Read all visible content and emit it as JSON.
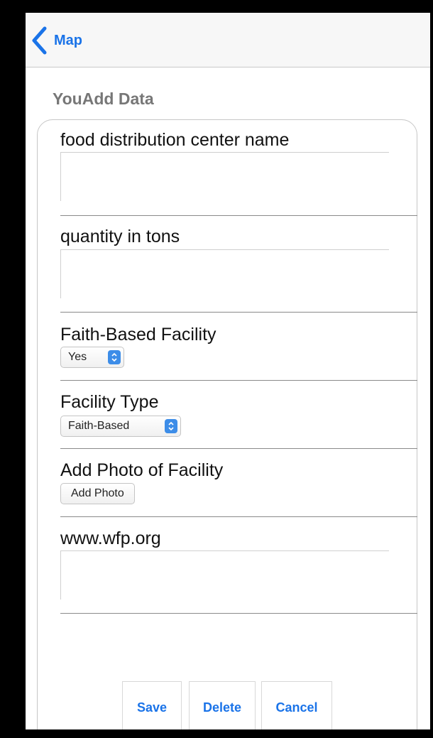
{
  "navbar": {
    "back_label": "Map",
    "back_icon": "chevron-left-icon",
    "accent_color": "#1a73e8"
  },
  "page": {
    "title": "YouAdd Data"
  },
  "form": {
    "name_label": "food distribution center name",
    "name_value": "",
    "quantity_label": "quantity in tons",
    "quantity_value": "",
    "faith_label": "Faith-Based Facility",
    "faith_selected": "Yes",
    "type_label": "Facility Type",
    "type_selected": "Faith-Based",
    "photo_label": "Add Photo of Facility",
    "photo_button": "Add Photo",
    "website_label": "www.wfp.org",
    "website_value": ""
  },
  "actions": {
    "save_label": "Save",
    "delete_label": "Delete",
    "cancel_label": "Cancel"
  },
  "icons": {
    "select_arrows": "updown-arrows-icon"
  }
}
